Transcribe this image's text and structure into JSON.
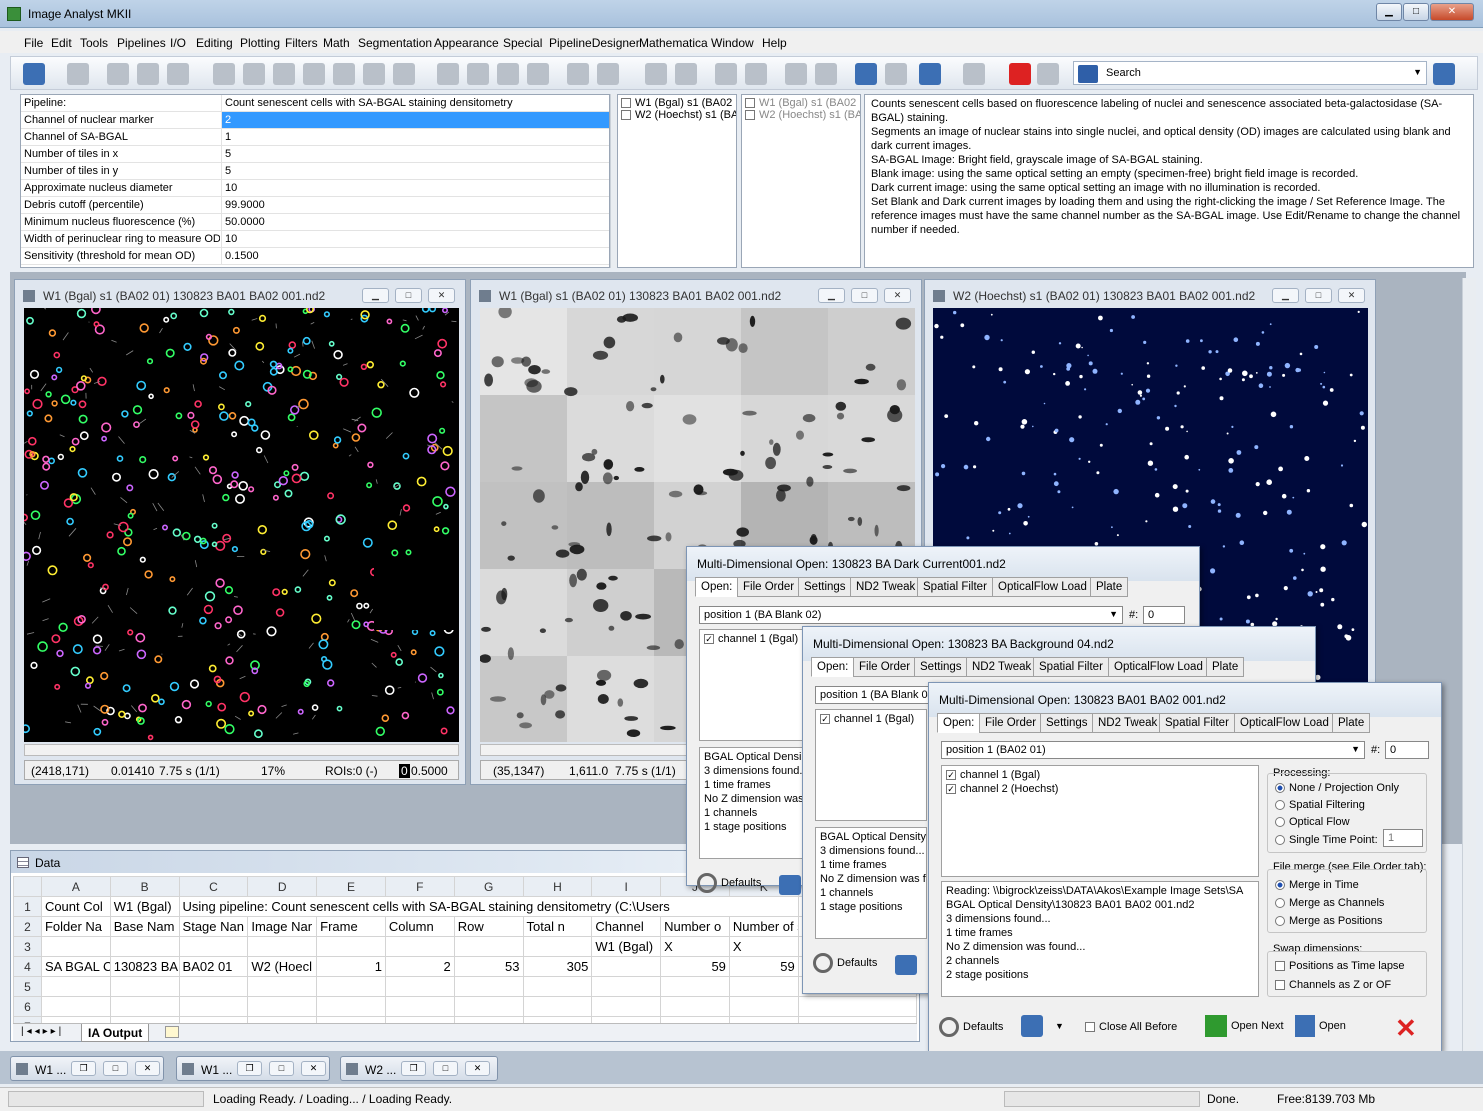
{
  "app": {
    "title": "Image Analyst MKII"
  },
  "window_controls": {
    "minimize": "▁",
    "maximize": "□",
    "close": "✕"
  },
  "menu": [
    "File",
    "Edit",
    "Tools",
    "Pipelines",
    "I/O",
    "Editing",
    "Plotting",
    "Filters",
    "Math",
    "Segmentation",
    "Appearance",
    "Special",
    "PipelineDesigner",
    "Mathematica",
    "Window",
    "Help"
  ],
  "search": {
    "label": "Search"
  },
  "pipeline": {
    "header_label": "Pipeline:",
    "header_value": "Count senescent cells with SA-BGAL staining densitometry",
    "params": [
      {
        "label": "Channel of nuclear marker",
        "value": "2"
      },
      {
        "label": "Channel of SA-BGAL",
        "value": "1"
      },
      {
        "label": "Number of tiles in x",
        "value": "5"
      },
      {
        "label": "Number of tiles in y",
        "value": "5"
      },
      {
        "label": "Approximate nucleus diameter",
        "value": "10"
      },
      {
        "label": "Debris cutoff (percentile)",
        "value": "99.9000"
      },
      {
        "label": "Minimum nucleus fluorescence (%)",
        "value": "50.0000"
      },
      {
        "label": "Width of perinuclear ring to measure OD",
        "value": "10"
      },
      {
        "label": "Sensitivity (threshold for mean OD)",
        "value": "0.1500"
      }
    ]
  },
  "channel_lists": {
    "left": [
      "W1 (Bgal) s1 (BA02",
      "W2 (Hoechst) s1 (BA"
    ],
    "right": [
      "W1 (Bgal) s1 (BA02",
      "W2 (Hoechst) s1 (BA"
    ]
  },
  "description": [
    "Counts senescent cells based on fluorescence labeling of nuclei and senescence associated beta-galactosidase (SA-BGAL) staining.",
    "Segments an image of nuclear stains into single nuclei, and optical density (OD) images are calculated using blank and dark current images.",
    "SA-BGAL Image: Bright field, grayscale image of SA-BGAL staining.",
    "Blank image: using the same optical setting an empty (specimen-free) bright field image is recorded.",
    "Dark current image: using the same optical setting an image with no illumination is recorded.",
    "Set Blank and Dark current images by loading them and using the right-clicking the image / Set Reference Image. The reference images must have the same channel number as the SA-BGAL image. Use Edit/Rename to change the channel number if needed."
  ],
  "image_windows": [
    {
      "title": "W1 (Bgal) s1 (BA02 01) 130823 BA01 BA02 001.nd2",
      "status": [
        "(2418,171)",
        "0.01410",
        "7.75 s (1/1)",
        "17%",
        "ROIs:0 (-)",
        "0.5000"
      ]
    },
    {
      "title": "W1 (Bgal) s1 (BA02 01) 130823 BA01 BA02 001.nd2",
      "status": [
        "(35,1347)",
        "1,611.0",
        "7.75 s (1/1)"
      ]
    },
    {
      "title": "W2 (Hoechst) s1 (BA02 01) 130823 BA01 BA02 001.nd2",
      "status": []
    }
  ],
  "dialogs": [
    {
      "title": "Multi-Dimensional Open: 130823 BA Dark Current001.nd2",
      "tabs": [
        "Open:",
        "File Order",
        "Settings",
        "ND2 Tweak",
        "Spatial Filter",
        "OpticalFlow Load",
        "Plate"
      ],
      "position": "position 1 (BA Blank 02)",
      "hash_label": "#:",
      "hash_value": "0",
      "channels": [
        "channel 1 (Bgal)"
      ],
      "log": [
        "BGAL Optical Densi",
        "3 dimensions found.",
        "1 time frames",
        "No Z dimension was",
        "1 channels",
        "1 stage positions"
      ],
      "defaults": "Defaults"
    },
    {
      "title": "Multi-Dimensional Open: 130823 BA Background 04.nd2",
      "tabs": [
        "Open:",
        "File Order",
        "Settings",
        "ND2 Tweak",
        "Spatial Filter",
        "OpticalFlow Load",
        "Plate"
      ],
      "position": "position 1 (BA Blank 04",
      "channels": [
        "channel 1 (Bgal)"
      ],
      "log": [
        "BGAL Optical Density\\",
        "3 dimensions found...",
        "1 time frames",
        "No Z dimension was f",
        "1 channels",
        "1 stage positions"
      ],
      "defaults": "Defaults"
    },
    {
      "title": "Multi-Dimensional Open: 130823 BA01 BA02 001.nd2",
      "tabs": [
        "Open:",
        "File Order",
        "Settings",
        "ND2 Tweak",
        "Spatial Filter",
        "OpticalFlow Load",
        "Plate"
      ],
      "position": "position 1 (BA02 01)",
      "hash_label": "#:",
      "hash_value": "0",
      "channels": [
        "channel 1 (Bgal)",
        "channel 2 (Hoechst)"
      ],
      "log": [
        "Reading: \\\\bigrock\\zeiss\\DATA\\Akos\\Example Image Sets\\SA",
        "BGAL Optical Density\\130823 BA01 BA02 001.nd2",
        "3 dimensions found...",
        "1 time frames",
        "No Z dimension was found...",
        "2 channels",
        "2 stage positions"
      ],
      "processing": {
        "label": "Processing:",
        "options": [
          "None / Projection Only",
          "Spatial Filtering",
          "Optical Flow",
          "Single Time Point:"
        ],
        "selected": 0,
        "time_point": "1"
      },
      "file_merge": {
        "label": "File merge (see File Order tab):",
        "options": [
          "Merge in Time",
          "Merge as Channels",
          "Merge as Positions"
        ],
        "selected": 0
      },
      "swap": {
        "label": "Swap dimensions:",
        "options": [
          "Positions as Time lapse",
          "Channels as Z or OF"
        ]
      },
      "defaults": "Defaults",
      "close_all": "Close All Before",
      "open_next": "Open Next",
      "open": "Open"
    }
  ],
  "data_window": {
    "title": "Data",
    "columns": [
      "A",
      "B",
      "C",
      "D",
      "E",
      "F",
      "G",
      "H",
      "I",
      "J",
      "K"
    ],
    "rows": [
      {
        "n": "1",
        "cells": [
          "Count Col",
          "W1 (Bgal)",
          "Using pipeline: Count senescent cells with SA-BGAL staining densitometry (C:\\Users",
          "",
          "",
          "",
          "",
          "",
          "",
          "",
          ""
        ]
      },
      {
        "n": "2",
        "cells": [
          "Folder Na",
          "Base Nam",
          "Stage Nan",
          "Image Nar",
          "Frame",
          "Column",
          "Row",
          "Total n",
          "Channel",
          "Number o",
          "Number of segmen"
        ]
      },
      {
        "n": "3",
        "cells": [
          "",
          "",
          "",
          "",
          "",
          "",
          "",
          "",
          "W1 (Bgal)",
          "X",
          "X"
        ]
      },
      {
        "n": "4",
        "cells": [
          "SA BGAL C",
          "130823 BA",
          "BA02 01",
          "W2 (Hoecl",
          "1",
          "2",
          "53",
          "305",
          "",
          "59",
          "59"
        ]
      },
      {
        "n": "5",
        "cells": [
          "",
          "",
          "",
          "",
          "",
          "",
          "",
          "",
          "",
          "",
          ""
        ]
      },
      {
        "n": "6",
        "cells": [
          "",
          "",
          "",
          "",
          "",
          "",
          "",
          "",
          "",
          "",
          ""
        ]
      },
      {
        "n": "7",
        "cells": [
          "",
          "",
          "",
          "",
          "",
          "",
          "",
          "",
          "",
          "",
          ""
        ]
      }
    ],
    "sheet_tab": "IA Output"
  },
  "taskbar": [
    "W1 ...",
    "W1 ...",
    "W2 ..."
  ],
  "statusbar": {
    "left": "Loading Ready.  / Loading... / Loading Ready.",
    "done": "Done.",
    "free": "Free:8139.703 Mb"
  },
  "colors": {
    "accent": "#3399ff",
    "title_gradient": "#bfd3e8",
    "close_red": "#d22222"
  }
}
